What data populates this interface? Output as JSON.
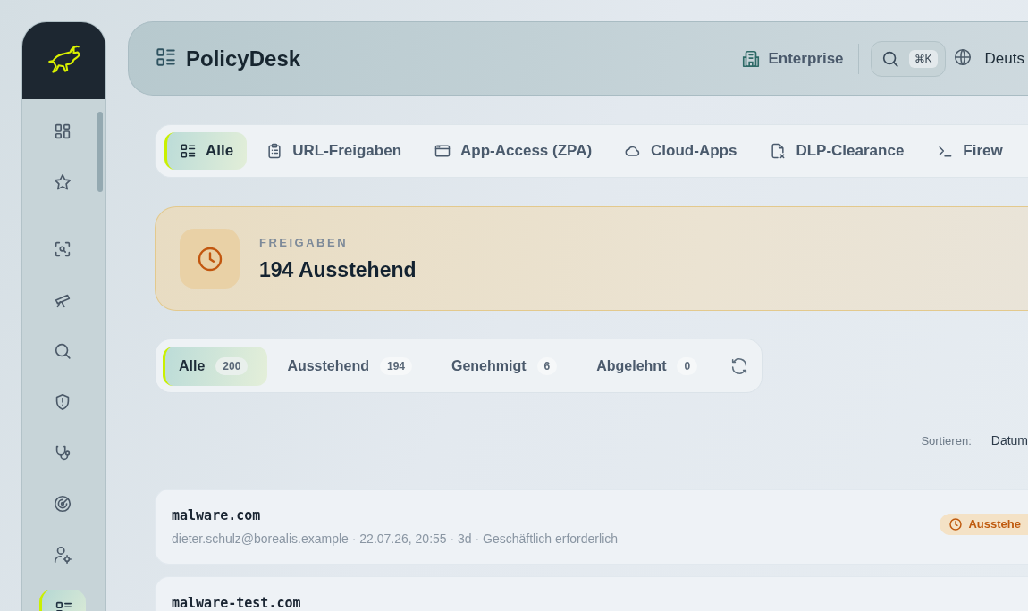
{
  "sidebar": {
    "items": [
      {
        "kind": "grid",
        "selected": false
      },
      {
        "kind": "star",
        "selected": false
      },
      {
        "kind": "scan",
        "selected": false
      },
      {
        "kind": "telescope",
        "selected": false
      },
      {
        "kind": "search",
        "selected": false
      },
      {
        "kind": "shield",
        "selected": false
      },
      {
        "kind": "stethoscope",
        "selected": false
      },
      {
        "kind": "radar",
        "selected": false
      },
      {
        "kind": "user-gear",
        "selected": false
      },
      {
        "kind": "list",
        "selected": true
      }
    ]
  },
  "header": {
    "title": "PolicyDesk",
    "plan": "Enterprise",
    "shortcut": "⌘K",
    "language": "Deuts"
  },
  "category_tabs": [
    {
      "label": "Alle",
      "kind": "list",
      "selected": true
    },
    {
      "label": "URL-Freigaben",
      "kind": "clipboard",
      "selected": false
    },
    {
      "label": "App-Access (ZPA)",
      "kind": "window",
      "selected": false
    },
    {
      "label": "Cloud-Apps",
      "kind": "cloud",
      "selected": false
    },
    {
      "label": "DLP-Clearance",
      "kind": "file-x",
      "selected": false
    },
    {
      "label": "Firew",
      "kind": "terminal",
      "selected": false
    }
  ],
  "banner": {
    "label": "FREIGABEN",
    "title": "194 Ausstehend"
  },
  "status_tabs": [
    {
      "label": "Alle",
      "count": "200",
      "selected": true
    },
    {
      "label": "Ausstehend",
      "count": "194",
      "selected": false
    },
    {
      "label": "Genehmigt",
      "count": "6",
      "selected": false
    },
    {
      "label": "Abgelehnt",
      "count": "0",
      "selected": false
    }
  ],
  "sort": {
    "label": "Sortieren:",
    "value": "Datum"
  },
  "requests": [
    {
      "domain": "malware.com",
      "meta": "dieter.schulz@borealis.example · 22.07.26, 20:55 · 3d · Geschäftlich erforderlich",
      "status": {
        "kind": "pending",
        "label": "Ausstehe"
      }
    },
    {
      "domain": "malware-test.com"
    }
  ]
}
